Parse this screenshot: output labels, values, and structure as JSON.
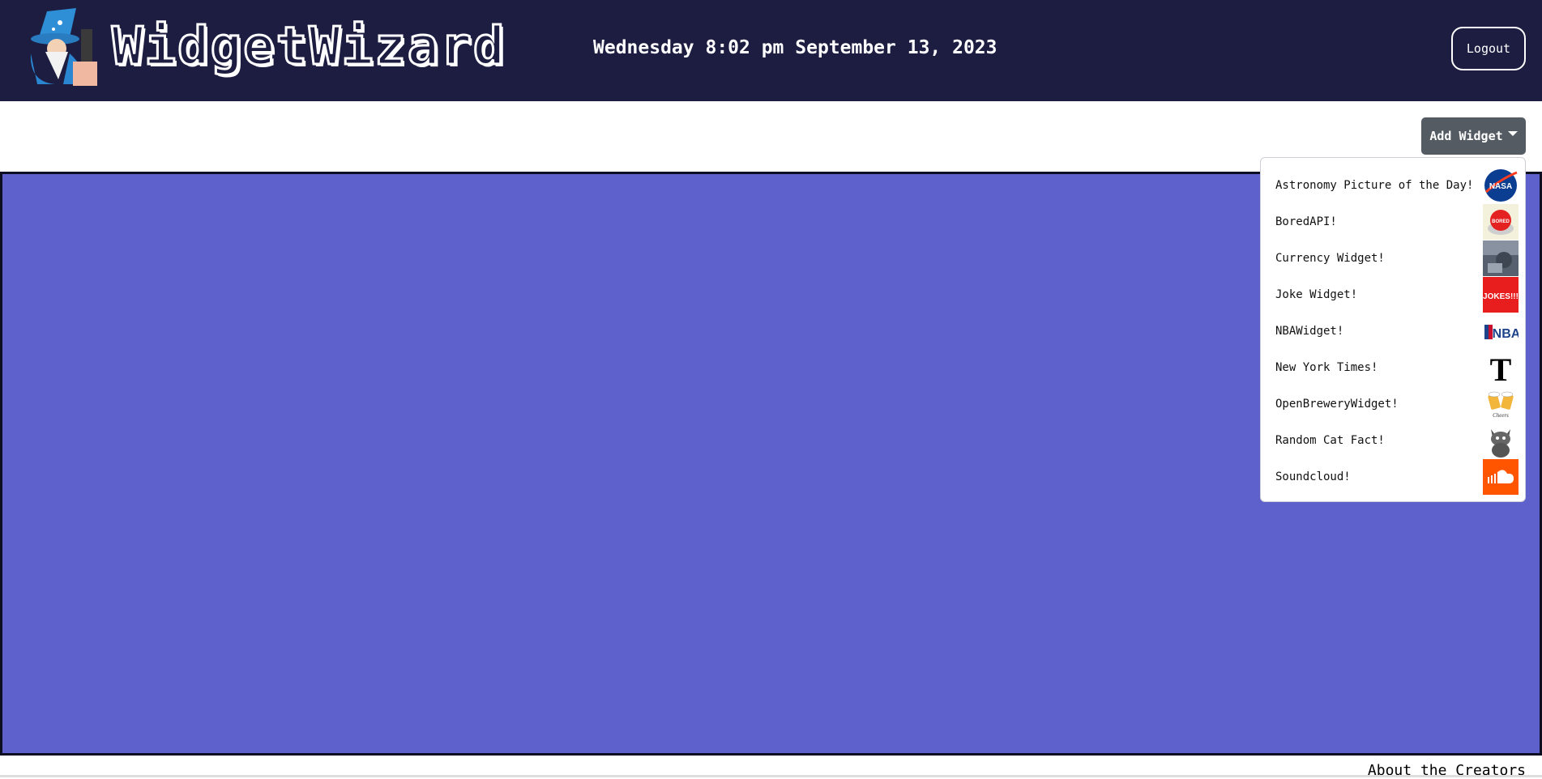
{
  "header": {
    "brand": "WidgetWizard",
    "datetime": "Wednesday 8:02 pm September 13, 2023",
    "logout_label": "Logout"
  },
  "toolbar": {
    "add_widget_label": "Add Widget"
  },
  "menu": {
    "items": [
      {
        "label": "Astronomy Picture of the Day!",
        "icon": "nasa-logo-icon"
      },
      {
        "label": "BoredAPI!",
        "icon": "bored-button-icon"
      },
      {
        "label": "Currency Widget!",
        "icon": "currency-photo-icon"
      },
      {
        "label": "Joke Widget!",
        "icon": "jokes-logo-icon"
      },
      {
        "label": "NBAWidget!",
        "icon": "nba-logo-icon"
      },
      {
        "label": "New York Times!",
        "icon": "nyt-logo-icon"
      },
      {
        "label": "OpenBreweryWidget!",
        "icon": "brewery-cheers-icon"
      },
      {
        "label": "Random Cat Fact!",
        "icon": "cat-icon"
      },
      {
        "label": "Soundcloud!",
        "icon": "soundcloud-logo-icon"
      }
    ],
    "badges": {
      "nasa": "NASA",
      "bored": "BORED",
      "jokes": "JOKES!!!",
      "nba": "NBA",
      "nyt": "T",
      "cheers": "Cheers"
    }
  },
  "footer": {
    "about_label": "About the Creators"
  },
  "colors": {
    "header_bg": "#1c1d40",
    "canvas_bg": "#5e61cc",
    "button_bg": "#545b62",
    "soundcloud": "#ff5500",
    "jokes": "#e81e1e",
    "nba": "#1d428a",
    "nasa": "#0b3d91"
  }
}
